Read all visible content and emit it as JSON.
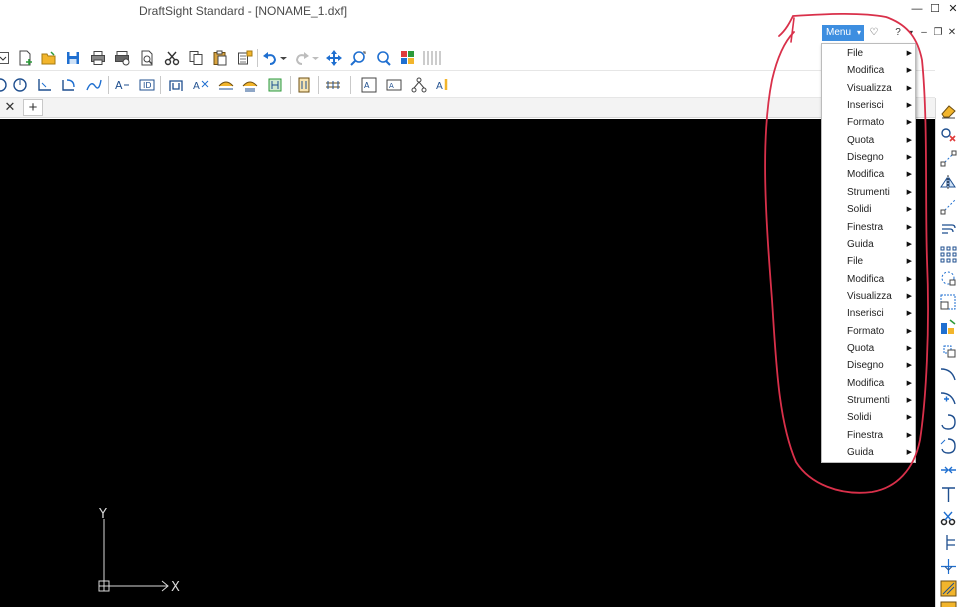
{
  "window": {
    "title": "DraftSight Standard - [NONAME_1.dxf]",
    "minimize_glyph": "—",
    "maximize_glyph": "☐",
    "close_glyph": "✕"
  },
  "menu_bar": {
    "menu_label": "Menu",
    "menu_arrow": "▾",
    "favorite_glyph": "♡",
    "help_glyph": "?",
    "help_arrow": "▾",
    "doc_minimize": "–",
    "doc_restore": "❐",
    "doc_close": "✕"
  },
  "tabs": {
    "close_glyph": "✕",
    "add_glyph": "+"
  },
  "dropdown": {
    "items": [
      {
        "label": "File"
      },
      {
        "label": "Modifica"
      },
      {
        "label": "Visualizza"
      },
      {
        "label": "Inserisci"
      },
      {
        "label": "Formato"
      },
      {
        "label": "Quota"
      },
      {
        "label": "Disegno"
      },
      {
        "label": "Modifica"
      },
      {
        "label": "Strumenti"
      },
      {
        "label": "Solidi"
      },
      {
        "label": "Finestra"
      },
      {
        "label": "Guida"
      },
      {
        "label": "File"
      },
      {
        "label": "Modifica"
      },
      {
        "label": "Visualizza"
      },
      {
        "label": "Inserisci"
      },
      {
        "label": "Formato"
      },
      {
        "label": "Quota"
      },
      {
        "label": "Disegno"
      },
      {
        "label": "Modifica"
      },
      {
        "label": "Strumenti"
      },
      {
        "label": "Solidi"
      },
      {
        "label": "Finestra"
      },
      {
        "label": "Guida"
      }
    ],
    "submenu_arrow": "▶"
  },
  "canvas": {
    "background": "#000000",
    "ucs_y_label": "Y",
    "ucs_x_label": "X"
  },
  "colors": {
    "accent": "#3d8ee0",
    "annotation": "#d9304a"
  }
}
